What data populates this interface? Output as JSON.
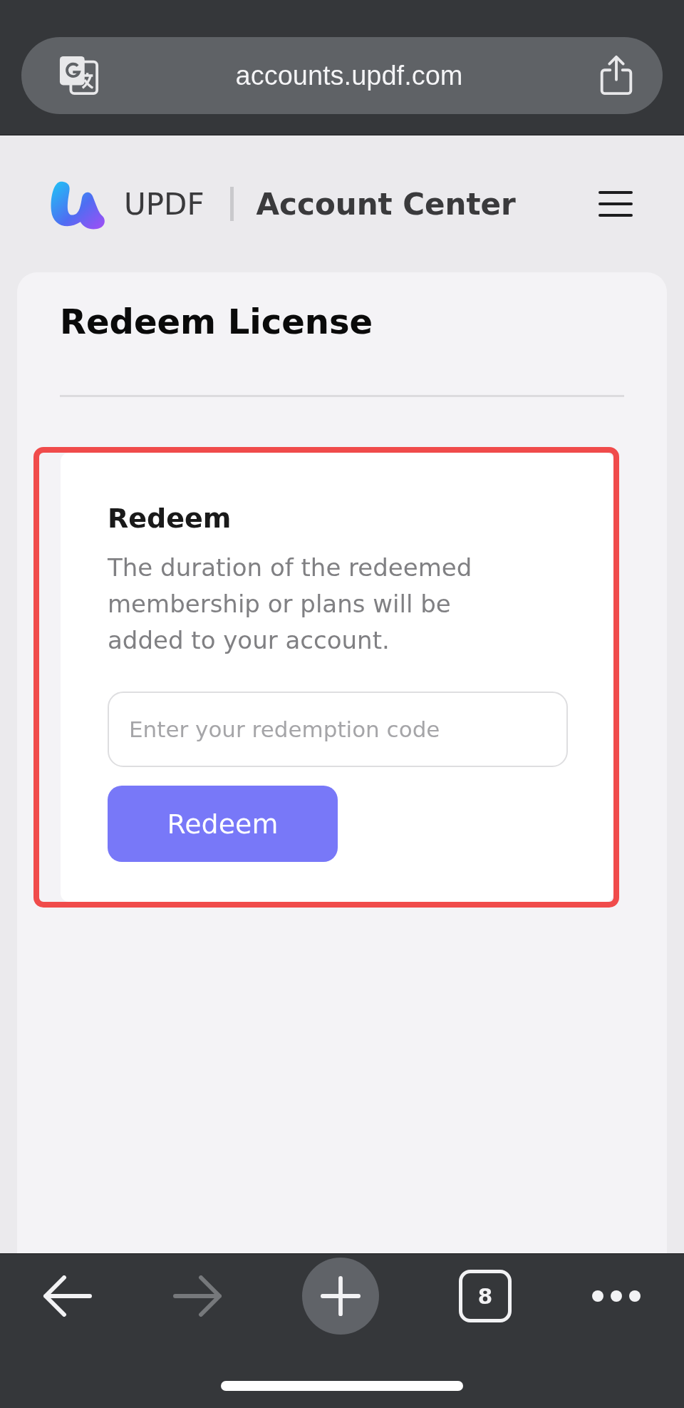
{
  "browser": {
    "url": "accounts.updf.com",
    "tab_count": "8",
    "forward_disabled": true
  },
  "header": {
    "brand": "UPDF",
    "section": "Account Center"
  },
  "page": {
    "title": "Redeem License"
  },
  "redeem_card": {
    "highlighted": true,
    "heading": "Redeem",
    "description": "The duration of the redeemed membership or plans will be added to your account.",
    "code_field": {
      "placeholder": "Enter your redemption code"
    },
    "button": "Redeem"
  }
}
